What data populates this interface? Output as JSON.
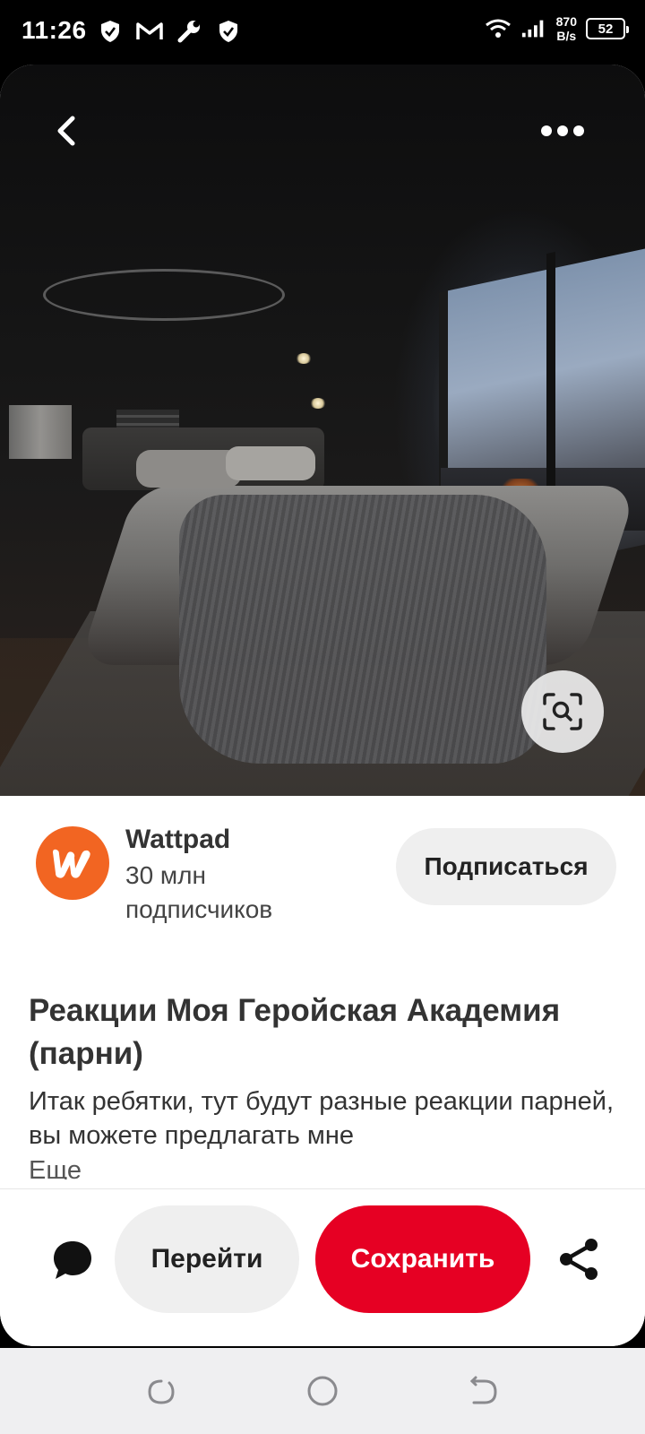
{
  "status_bar": {
    "time": "11:26",
    "net_speed_value": "870",
    "net_speed_unit": "B/s",
    "battery": "52",
    "left_icons": [
      "shield-icon",
      "gmail-icon",
      "wrench-icon",
      "shield-icon"
    ],
    "right_icons": [
      "wifi-icon",
      "signal-icon"
    ]
  },
  "hero": {
    "top_left_icon": "back-chevron-icon",
    "top_right_icon": "more-dots-icon",
    "bottom_right_icon": "visual-search-icon"
  },
  "creator": {
    "name": "Wattpad",
    "followers": "30 млн подписчиков",
    "follow_label": "Подписаться",
    "avatar_color": "#f26522"
  },
  "pin": {
    "title": "Реакции Моя Геройская Академия (парни)",
    "description": "Итак ребятки, тут будут разные реакции парней, вы можете предлагать мне",
    "more_label": "Еще"
  },
  "actions": {
    "visit_label": "Перейти",
    "save_label": "Сохранить",
    "save_color": "#e60023",
    "comment_icon": "comment-bubble-icon",
    "share_icon": "share-icon"
  },
  "nav": {
    "buttons": [
      "recents-icon",
      "home-icon",
      "back-icon"
    ]
  }
}
